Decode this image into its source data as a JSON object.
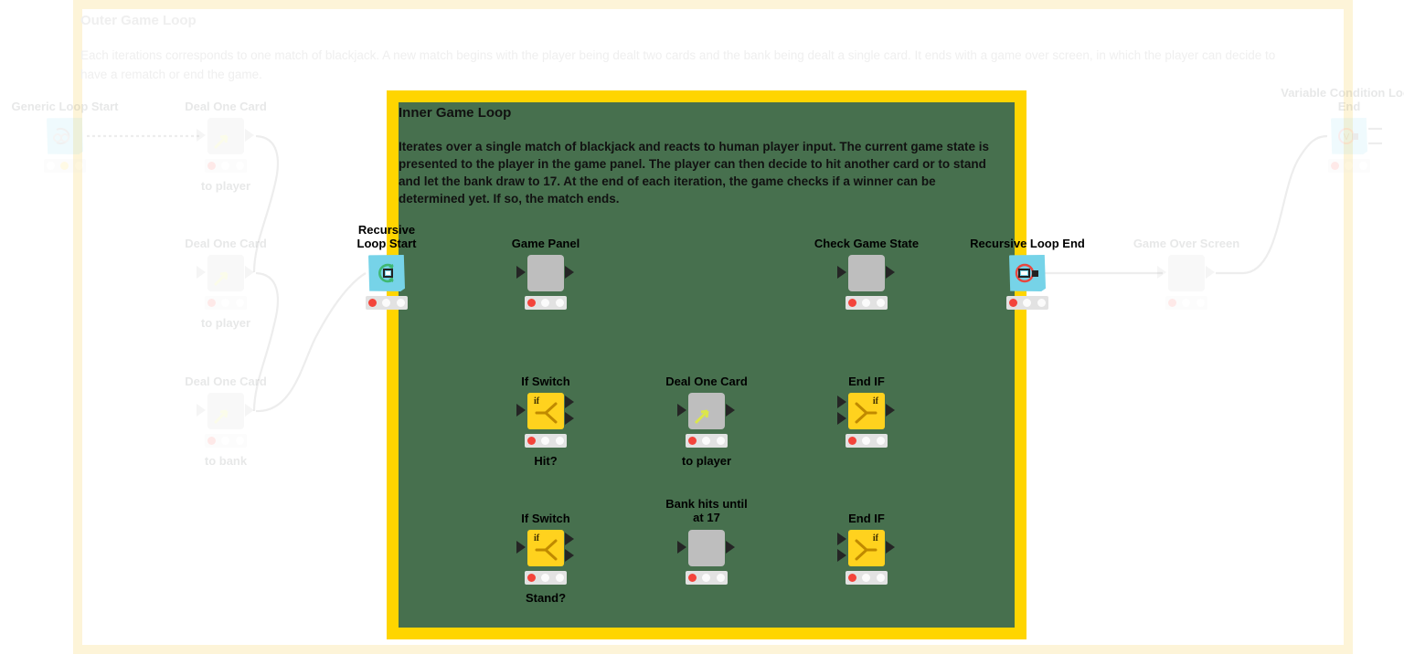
{
  "colors": {
    "inner_frame_border": "#FFD500",
    "inner_frame_fill": "#47704E",
    "outer_frame_border": "#FDF4D8",
    "node_gray": "#BEBEBE",
    "node_yellow": "#FFD21E",
    "node_blue": "#76D3E8",
    "led_red": "#F3443B",
    "led_yellow": "#FFD21E",
    "wire": "#9B9B9B"
  },
  "outer_loop": {
    "title": "Outer Game Loop",
    "description": "Each iterations corresponds to one match of blackjack. A new match begins with the player being dealt two cards and the bank being dealt a single card. It ends with a game over screen, in which the player can decide to have a rematch or end the game."
  },
  "inner_loop": {
    "title": "Inner Game Loop",
    "description": "Iterates over a single match of blackjack and reacts to human player input. The current game state is presented to the player in the game panel. The player can then decide to hit another card or to stand and let the bank draw to 17. At the end of each iteration, the game checks if a winner can be determined yet. If so, the match ends."
  },
  "nodes": {
    "generic_loop_start": {
      "title": "Generic Loop Start",
      "subtitle": "",
      "icon": "infinity-loop-icon",
      "leds": [
        "off",
        "yellow",
        "off"
      ]
    },
    "deal_card_player_1": {
      "title": "Deal One Card",
      "subtitle": "to player",
      "icon": "arrow-deal-icon",
      "leds": [
        "red",
        "off",
        "off"
      ]
    },
    "deal_card_player_2": {
      "title": "Deal One Card",
      "subtitle": "to player",
      "icon": "arrow-deal-icon",
      "leds": [
        "red",
        "off",
        "off"
      ]
    },
    "deal_card_bank": {
      "title": "Deal One Card",
      "subtitle": "to bank",
      "icon": "arrow-deal-icon",
      "leds": [
        "red",
        "off",
        "off"
      ]
    },
    "recursive_loop_start": {
      "title": "Recursive Loop Start",
      "subtitle": "",
      "icon": "recursion-start-icon",
      "leds": [
        "red",
        "off",
        "off"
      ]
    },
    "game_panel": {
      "title": "Game Panel",
      "subtitle": "",
      "icon": "panel-icon",
      "leds": [
        "red",
        "off",
        "off"
      ]
    },
    "if_switch_hit": {
      "title": "If Switch",
      "subtitle": "Hit?",
      "icon": "if-switch-icon",
      "leds": [
        "red",
        "off",
        "off"
      ]
    },
    "deal_card_hit": {
      "title": "Deal One Card",
      "subtitle": "to player",
      "icon": "arrow-deal-icon",
      "leds": [
        "red",
        "off",
        "off"
      ]
    },
    "end_if_hit": {
      "title": "End IF",
      "subtitle": "",
      "icon": "end-if-icon",
      "leds": [
        "red",
        "off",
        "off"
      ]
    },
    "if_switch_stand": {
      "title": "If Switch",
      "subtitle": "Stand?",
      "icon": "if-switch-icon",
      "leds": [
        "red",
        "off",
        "off"
      ]
    },
    "bank_hits": {
      "title": "Bank hits until at 17",
      "subtitle": "",
      "icon": "panel-icon",
      "leds": [
        "red",
        "off",
        "off"
      ]
    },
    "end_if_stand": {
      "title": "End IF",
      "subtitle": "",
      "icon": "end-if-icon",
      "leds": [
        "red",
        "off",
        "off"
      ]
    },
    "check_game_state": {
      "title": "Check Game State",
      "subtitle": "",
      "icon": "panel-icon",
      "leds": [
        "red",
        "off",
        "off"
      ]
    },
    "recursive_loop_end": {
      "title": "Recursive Loop End",
      "subtitle": "",
      "icon": "recursion-end-icon",
      "leds": [
        "red",
        "off",
        "off"
      ]
    },
    "game_over_screen": {
      "title": "Game Over Screen",
      "subtitle": "",
      "icon": "panel-icon",
      "leds": [
        "red",
        "off",
        "off"
      ]
    },
    "variable_condition_loop_end": {
      "title": "Variable Condition Loop End",
      "subtitle": "",
      "icon": "variable-loop-end-icon",
      "leds": [
        "red",
        "off",
        "off"
      ]
    }
  }
}
